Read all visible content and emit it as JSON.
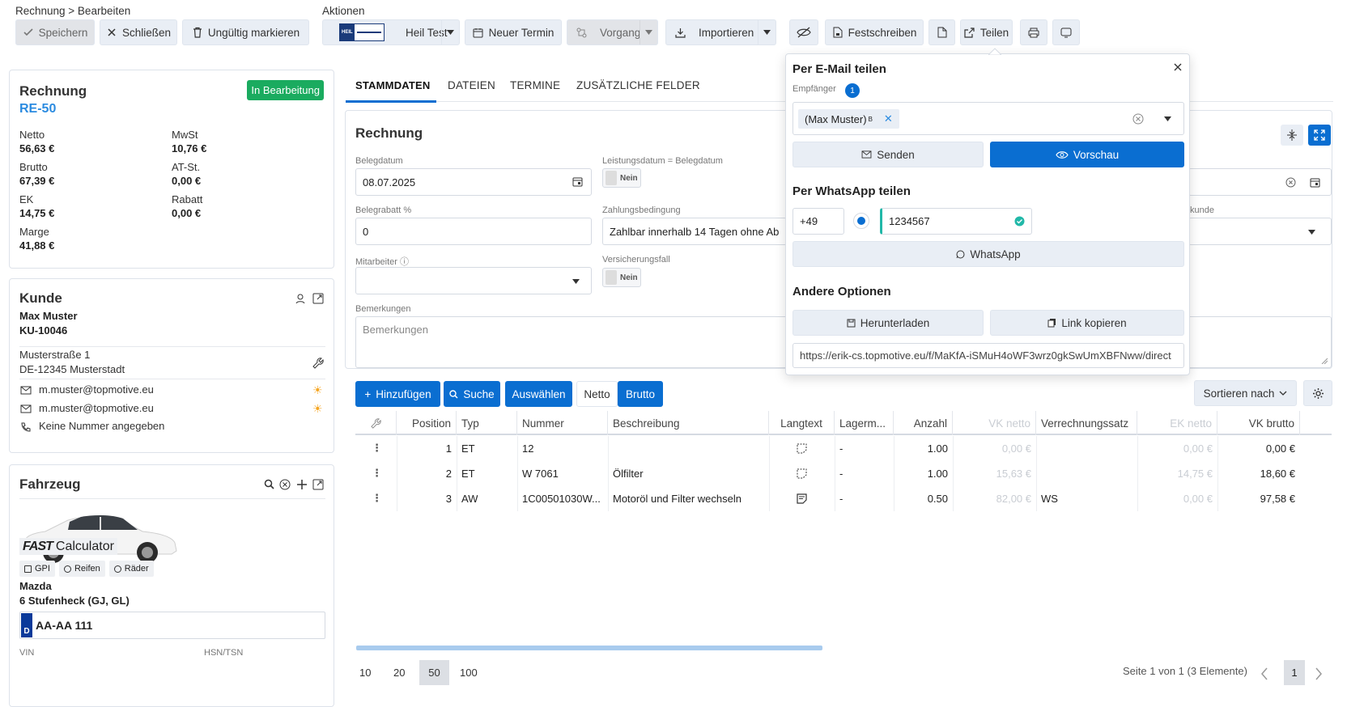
{
  "breadcrumb": "Rechnung > Bearbeiten",
  "actions_label": "Aktionen",
  "toolbar": {
    "save": "Speichern",
    "close": "Schließen",
    "invalidate": "Ungültig markieren",
    "company": "Heil Test",
    "company_logo_text": "HEIL",
    "appointment": "Neuer Termin",
    "process": "Vorgang",
    "import": "Importieren",
    "commit": "Festschreiben",
    "share": "Teilen"
  },
  "invoice": {
    "title": "Rechnung",
    "number": "RE-50",
    "status": "In Bearbeitung",
    "status_color": "#1aab5f",
    "summary": [
      {
        "label": "Netto",
        "value": "56,63 €"
      },
      {
        "label": "MwSt",
        "value": "10,76 €"
      },
      {
        "label": "Brutto",
        "value": "67,39 €"
      },
      {
        "label": "AT-St.",
        "value": "0,00 €"
      },
      {
        "label": "EK",
        "value": "14,75 €"
      },
      {
        "label": "Rabatt",
        "value": "0,00 €"
      },
      {
        "label": "Marge",
        "value": "41,88 €"
      }
    ]
  },
  "customer": {
    "title": "Kunde",
    "name": "Max Muster",
    "id": "KU-10046",
    "street": "Musterstraße 1",
    "city": "DE-12345 Musterstadt",
    "email1": "m.muster@topmotive.eu",
    "email2": "m.muster@topmotive.eu",
    "phone": "Keine Nummer angegeben"
  },
  "vehicle": {
    "title": "Fahrzeug",
    "calc_brand": "FAST",
    "calc_text": "Calculator",
    "tags": [
      "GPI",
      "Reifen",
      "Räder"
    ],
    "make": "Mazda",
    "model": "6 Stufenheck (GJ, GL)",
    "plate_country": "D",
    "plate": "AA-AA 111",
    "vin_label": "VIN",
    "hsn_label": "HSN/TSN"
  },
  "tabs": [
    "STAMMDATEN",
    "DATEIEN",
    "TERMINE",
    "ZUSÄTZLICHE FELDER"
  ],
  "form": {
    "section": "Rechnung",
    "belegdatum_label": "Belegdatum",
    "belegdatum": "08.07.2025",
    "leistungsdatum_label": "Leistungsdatum = Belegdatum",
    "toggle_no": "Nein",
    "rabatt_label": "Belegrabatt %",
    "rabatt": "0",
    "zahlung_label": "Zahlungsbedingung",
    "zahlung": "Zahlbar innerhalb 14 Tagen ohne Ab",
    "mitarbeiter_label": "Mitarbeiter",
    "versicherung_label": "Versicherungsfall",
    "bemerkungen_label": "Bemerkungen",
    "bemerkungen_ph": "Bemerkungen",
    "kunde_label_partial": "kunde"
  },
  "list_toolbar": {
    "add": "Hinzufügen",
    "search": "Suche",
    "select": "Auswählen",
    "netto": "Netto",
    "brutto": "Brutto",
    "sort": "Sortieren nach"
  },
  "table": {
    "headers": [
      "Position",
      "Typ",
      "Nummer",
      "Beschreibung",
      "Langtext",
      "Lagerm...",
      "Anzahl",
      "VK netto",
      "Verrechnungssatz",
      "EK netto",
      "VK brutto"
    ],
    "rows": [
      {
        "pos": "1",
        "typ": "ET",
        "nummer": "12",
        "beschreibung": "",
        "lager": "-",
        "anzahl": "1.00",
        "vknetto": "0,00 €",
        "satz": "",
        "eknetto": "0,00 €",
        "vkbrutto": "0,00 €"
      },
      {
        "pos": "2",
        "typ": "ET",
        "nummer": "W 7061",
        "beschreibung": "Ölfilter",
        "lager": "-",
        "anzahl": "1.00",
        "vknetto": "15,63 €",
        "satz": "",
        "eknetto": "14,75 €",
        "vkbrutto": "18,60 €"
      },
      {
        "pos": "3",
        "typ": "AW",
        "nummer": "1C00501030W...",
        "beschreibung": "Motoröl und Filter wechseln",
        "lager": "-",
        "anzahl": "0.50",
        "vknetto": "82,00 €",
        "satz": "WS",
        "eknetto": "0,00 €",
        "vkbrutto": "97,58 €"
      }
    ]
  },
  "pager": {
    "sizes": [
      "10",
      "20",
      "50",
      "100"
    ],
    "active": "50",
    "info": "Seite 1 von 1 (3 Elemente)",
    "page": "1"
  },
  "share": {
    "email_title": "Per E-Mail teilen",
    "recipients_label": "Empfänger",
    "recipients_count": "1",
    "recipient": "(Max Muster)",
    "recipient_sup": "B",
    "send": "Senden",
    "preview": "Vorschau",
    "wa_title": "Per WhatsApp teilen",
    "country_code": "+49",
    "phone": "1234567",
    "whatsapp": "WhatsApp",
    "other_title": "Andere Optionen",
    "download": "Herunterladen",
    "copy_link": "Link kopieren",
    "link": "https://erik-cs.topmotive.eu/f/MaKfA-iSMuH4oWF3wrz0gkSwUmXBFNww/direct"
  },
  "colors": {
    "accent": "#0a6ed1",
    "link": "#2b8be0",
    "success": "#1aab5f",
    "warning": "#f5a623"
  }
}
